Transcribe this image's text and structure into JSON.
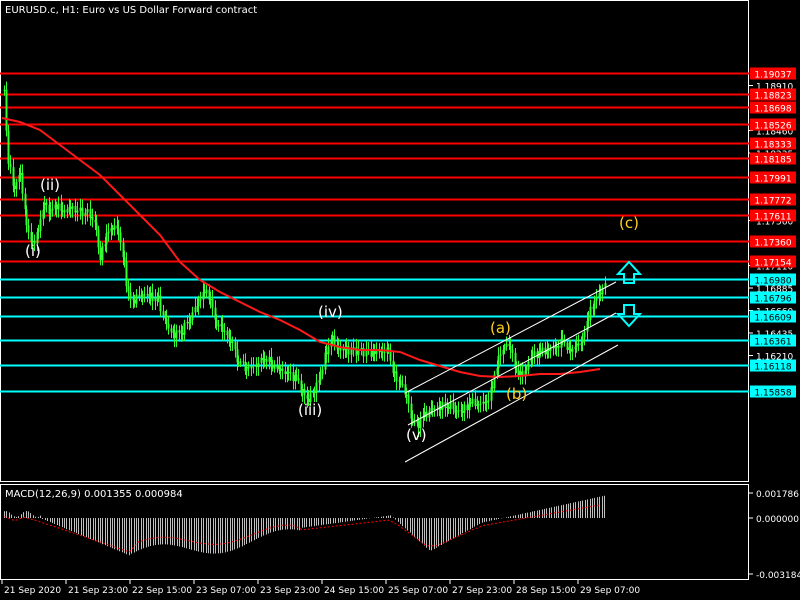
{
  "header": {
    "title": "EURUSD.c, H1:  Euro vs US Dollar Forward contract"
  },
  "macd": {
    "label": "MACD(12,26,9) 0.001355 0.000984",
    "scale": [
      "0.001786",
      "0.000000",
      "-0.003184"
    ]
  },
  "price_scale": [
    "1.18910",
    "1.18460",
    "1.18235",
    "1.17560",
    "1.17110",
    "1.16885",
    "1.16660",
    "1.16435",
    "1.16210"
  ],
  "level_labels": [
    {
      "text": "1.19037",
      "kind": "resistance"
    },
    {
      "text": "1.18823",
      "kind": "resistance"
    },
    {
      "text": "1.18698",
      "kind": "resistance"
    },
    {
      "text": "1.18526",
      "kind": "resistance"
    },
    {
      "text": "1.18333",
      "kind": "resistance"
    },
    {
      "text": "1.18185",
      "kind": "resistance"
    },
    {
      "text": "1.17991",
      "kind": "resistance"
    },
    {
      "text": "1.17772",
      "kind": "resistance"
    },
    {
      "text": "1.17611",
      "kind": "resistance"
    },
    {
      "text": "1.17360",
      "kind": "resistance"
    },
    {
      "text": "1.17154",
      "kind": "resistance"
    },
    {
      "text": "1.16980",
      "kind": "support"
    },
    {
      "text": "1.16796",
      "kind": "support"
    },
    {
      "text": "1.16609",
      "kind": "support"
    },
    {
      "text": "1.16361",
      "kind": "support"
    },
    {
      "text": "1.16118",
      "kind": "support"
    },
    {
      "text": "1.15858",
      "kind": "support"
    }
  ],
  "time_axis": [
    "21 Sep 2020",
    "21 Sep 23:00",
    "22 Sep 15:00",
    "23 Sep 07:00",
    "23 Sep 23:00",
    "24 Sep 15:00",
    "25 Sep 07:00",
    "27 Sep 23:00",
    "28 Sep 15:00",
    "29 Sep 07:00"
  ],
  "wave_labels": {
    "i": "(i)",
    "ii": "(ii)",
    "iii": "(iii)",
    "iv": "(iv)",
    "v": "(v)",
    "a": "(a)",
    "b": "(b)",
    "c": "(c)"
  },
  "colors": {
    "background": "#000000",
    "grid": "#ffffff",
    "resistance": "#ff0000",
    "support": "#00ffff",
    "candles": "#33ff33",
    "moving_average": "#ff1a1a",
    "channel": "#ffffff",
    "wave_white": "#ffffff",
    "wave_yellow": "#ffd21f",
    "macd_hist": "#c0c0c0",
    "macd_signal": "#ff0000"
  },
  "icons": {
    "up_arrow": "arrow-up-icon",
    "down_arrow": "arrow-down-icon"
  }
}
